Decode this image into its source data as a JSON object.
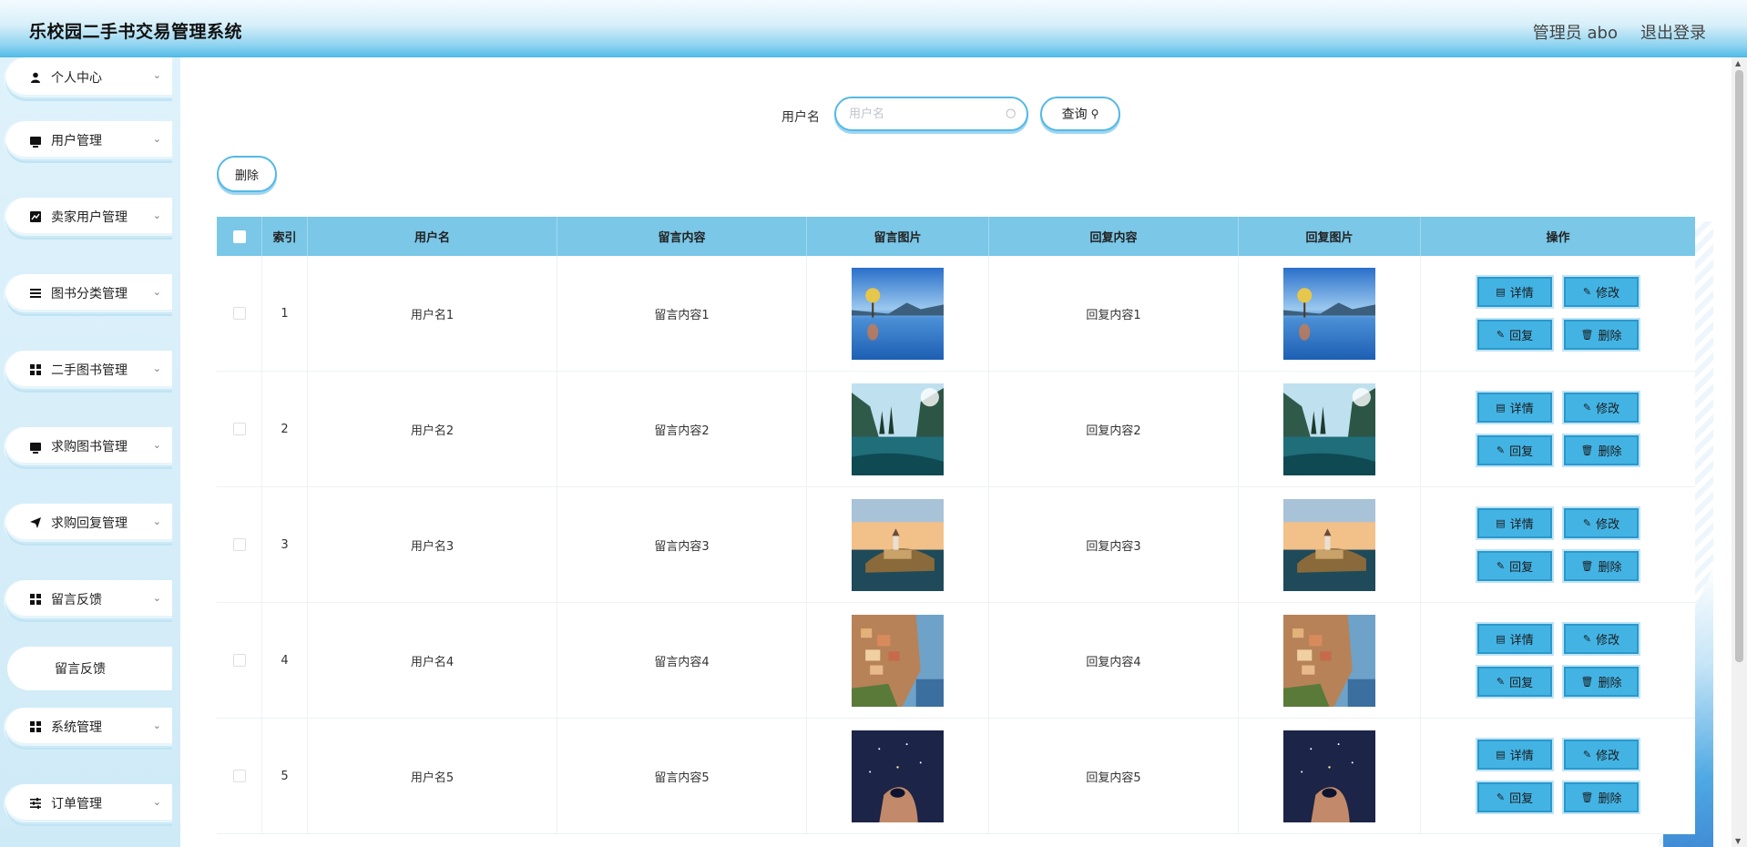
{
  "header": {
    "title": "乐校园二手书交易管理系统",
    "user": "管理员 abo",
    "logout": "退出登录"
  },
  "sidebar": {
    "items": [
      {
        "label": "个人中心",
        "icon": "user-icon"
      },
      {
        "label": "用户管理",
        "icon": "monitor-icon"
      },
      {
        "label": "卖家用户管理",
        "icon": "chart-icon"
      },
      {
        "label": "图书分类管理",
        "icon": "list-icon"
      },
      {
        "label": "二手图书管理",
        "icon": "grid-icon"
      },
      {
        "label": "求购图书管理",
        "icon": "monitor-icon"
      },
      {
        "label": "求购回复管理",
        "icon": "send-icon"
      },
      {
        "label": "留言反馈",
        "icon": "grid-icon"
      },
      {
        "label": "系统管理",
        "icon": "grid-icon"
      },
      {
        "label": "订单管理",
        "icon": "sliders-icon"
      }
    ],
    "active_submenu": "留言反馈"
  },
  "search": {
    "label": "用户名",
    "placeholder": "用户名",
    "button": "查询"
  },
  "toolbar": {
    "delete_label": "删除"
  },
  "table": {
    "columns": [
      "索引",
      "用户名",
      "留言内容",
      "留言图片",
      "回复内容",
      "回复图片",
      "操作"
    ],
    "rows": [
      {
        "index": "1",
        "user": "用户名1",
        "message": "留言内容1",
        "reply": "回复内容1",
        "image": "lake-tree"
      },
      {
        "index": "2",
        "user": "用户名2",
        "message": "留言内容2",
        "reply": "回复内容2",
        "image": "mountain-lake"
      },
      {
        "index": "3",
        "user": "用户名3",
        "message": "留言内容3",
        "reply": "回复内容3",
        "image": "castle-island"
      },
      {
        "index": "4",
        "user": "用户名4",
        "message": "留言内容4",
        "reply": "回复内容4",
        "image": "cliff-village"
      },
      {
        "index": "5",
        "user": "用户名5",
        "message": "留言内容5",
        "reply": "回复内容5",
        "image": "night-hand"
      }
    ],
    "actions": {
      "detail": "详情",
      "edit": "修改",
      "reply": "回复",
      "delete": "删除"
    }
  },
  "colors": {
    "accent": "#43b3e4",
    "header_bottom": "#55bde8",
    "table_header": "#7ac7e8",
    "sidebar_bg": "#dff2fb"
  }
}
